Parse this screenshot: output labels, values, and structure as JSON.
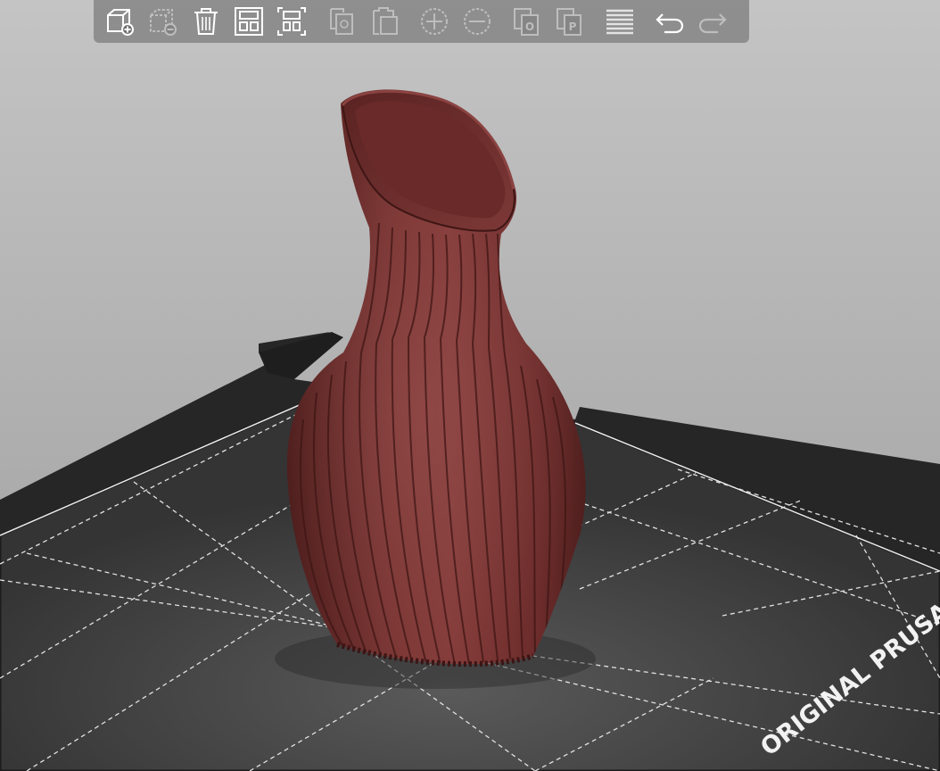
{
  "window": {
    "title": ""
  },
  "viewport": {
    "bed_brand_text": "ORIGINAL PRUSA",
    "object": {
      "name-icon": "vase",
      "color": "#6e2e2c"
    },
    "colors": {
      "bed": "#3a3a3a",
      "bed_edge": "#242424",
      "grid": "#e6e6e6",
      "background_top": "#c4c4c4",
      "background_bottom": "#9d9d9d",
      "object": "#6e2e2c",
      "object_highlight": "#8c4240",
      "object_shadow": "#4a1c1b"
    }
  },
  "toolbar": {
    "buttons": [
      {
        "icon": "add-object-icon",
        "enabled": true
      },
      {
        "icon": "delete-object-icon",
        "enabled": false
      },
      {
        "icon": "delete-all-icon",
        "enabled": true
      },
      {
        "icon": "arrange-icon",
        "enabled": true
      },
      {
        "icon": "arrange-selection-icon",
        "enabled": true
      },
      {
        "icon": "copy-icon",
        "enabled": false
      },
      {
        "icon": "paste-icon",
        "enabled": false
      },
      {
        "icon": "add-instance-icon",
        "enabled": false
      },
      {
        "icon": "remove-instance-icon",
        "enabled": false
      },
      {
        "icon": "split-to-objects-icon",
        "enabled": false
      },
      {
        "icon": "split-to-parts-icon",
        "enabled": false
      },
      {
        "icon": "layer-editing-icon",
        "enabled": true
      },
      {
        "icon": "undo-icon",
        "enabled": true
      },
      {
        "icon": "redo-icon",
        "enabled": false
      }
    ]
  }
}
